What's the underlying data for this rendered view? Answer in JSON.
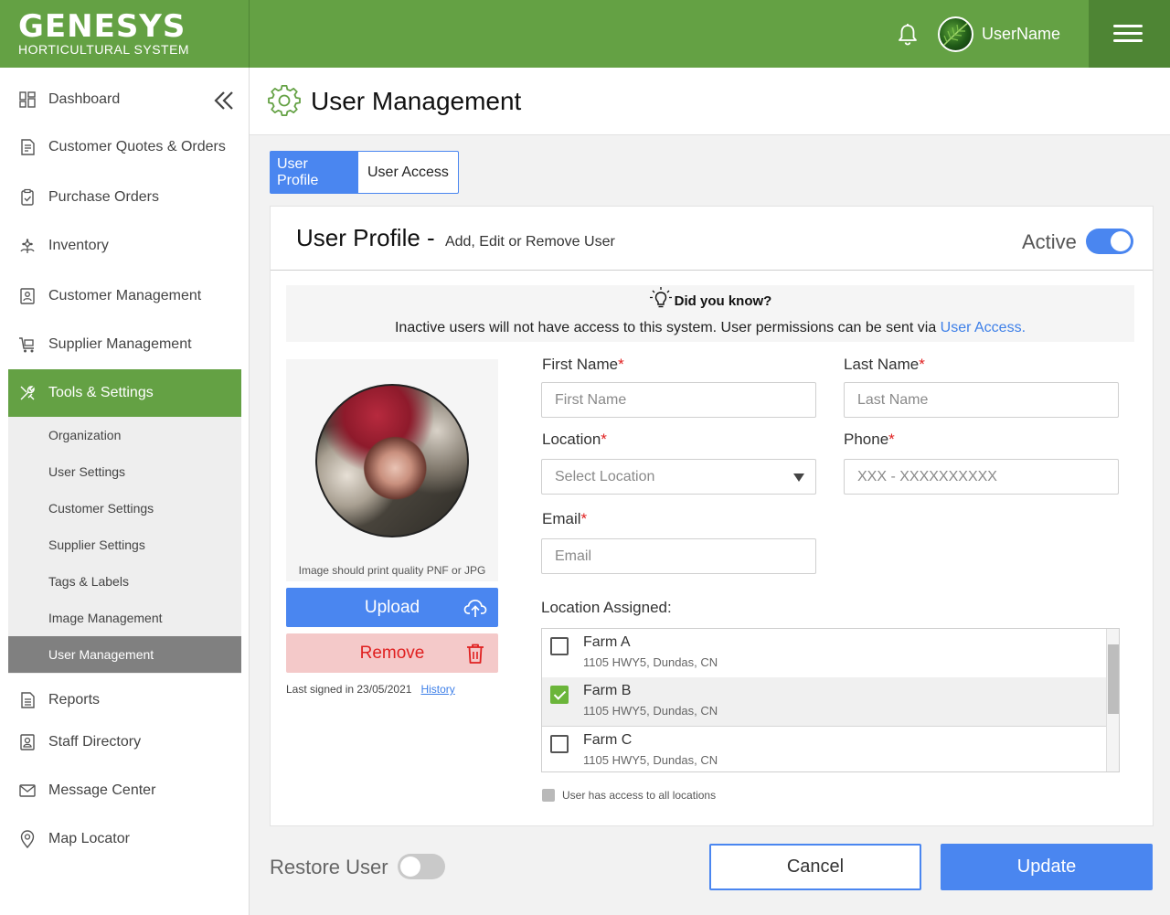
{
  "header": {
    "brand": "GENESYS",
    "tagline": "HORTICULTURAL SYSTEM",
    "username": "UserName",
    "colors": {
      "primary": "#64a144",
      "accent": "#4a86f0"
    }
  },
  "sidebar": {
    "items": [
      {
        "label": "Dashboard",
        "icon": "dashboard-icon"
      },
      {
        "label": "Customer Quotes & Orders",
        "icon": "document-icon"
      },
      {
        "label": "Purchase Orders",
        "icon": "clipboard-check-icon"
      },
      {
        "label": "Inventory",
        "icon": "plant-icon"
      },
      {
        "label": "Customer Management",
        "icon": "contact-card-icon"
      },
      {
        "label": "Supplier Management",
        "icon": "cart-icon"
      },
      {
        "label": "Tools & Settings",
        "icon": "tools-icon"
      },
      {
        "label": "Reports",
        "icon": "report-icon"
      },
      {
        "label": "Staff Directory",
        "icon": "id-badge-icon"
      },
      {
        "label": "Message Center",
        "icon": "mail-icon"
      },
      {
        "label": "Map Locator",
        "icon": "map-pin-icon"
      }
    ],
    "subitems": [
      {
        "label": "Organization"
      },
      {
        "label": "User Settings"
      },
      {
        "label": "Customer Settings"
      },
      {
        "label": "Supplier Settings"
      },
      {
        "label": "Tags & Labels"
      },
      {
        "label": "Image Management"
      },
      {
        "label": "User Management"
      }
    ]
  },
  "page": {
    "title": "User Management"
  },
  "tabs": [
    "User Profile",
    "User Access"
  ],
  "card": {
    "title": "User Profile -",
    "subtitle": "Add, Edit or Remove User",
    "active_label": "Active",
    "active_on": true
  },
  "tip": {
    "title": "Did you know?",
    "text": "Inactive users will not have access to this system. User permissions can be sent via ",
    "link": "User Access."
  },
  "photo": {
    "note": "Image should print quality PNF or JPG",
    "upload": "Upload",
    "remove": "Remove",
    "last_signed": "Last signed in 23/05/2021",
    "history": "History"
  },
  "form": {
    "first_name": {
      "label": "First Name",
      "placeholder": "First Name"
    },
    "last_name": {
      "label": "Last Name",
      "placeholder": "Last Name"
    },
    "location": {
      "label": "Location",
      "placeholder": "Select Location"
    },
    "phone": {
      "label": "Phone",
      "placeholder": "XXX - XXXXXXXXXX"
    },
    "email": {
      "label": "Email",
      "placeholder": "Email"
    },
    "required_mark": "*",
    "location_assigned_label": "Location Assigned:",
    "locations": [
      {
        "name": "Farm A",
        "address": "1105 HWY5, Dundas, CN",
        "checked": false
      },
      {
        "name": "Farm B",
        "address": "1105 HWY5, Dundas, CN",
        "checked": true
      },
      {
        "name": "Farm C",
        "address": "1105 HWY5, Dundas, CN",
        "checked": false
      }
    ],
    "all_locations_label": "User has access to all locations"
  },
  "footer": {
    "restore_label": "Restore User",
    "restore_on": false,
    "cancel": "Cancel",
    "update": "Update"
  }
}
